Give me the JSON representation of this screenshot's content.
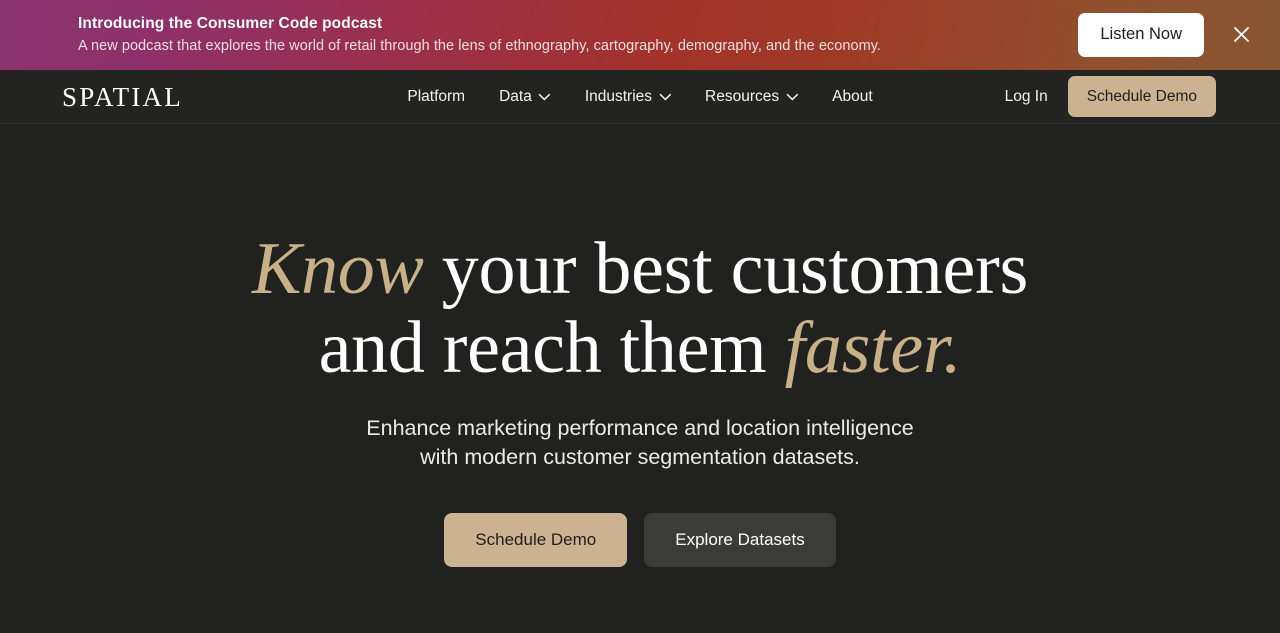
{
  "banner": {
    "title": "Introducing the Consumer Code podcast",
    "subtitle": "A new podcast that explores the world of retail through the lens of ethnography, cartography, demography, and the economy.",
    "cta_label": "Listen Now",
    "close_icon": "close-icon",
    "gradient_start": "#8a3470",
    "gradient_mid": "#a33229",
    "gradient_end": "#885631"
  },
  "nav": {
    "logo": "SPATIAL",
    "links": [
      {
        "label": "Platform",
        "has_dropdown": false
      },
      {
        "label": "Data",
        "has_dropdown": true
      },
      {
        "label": "Industries",
        "has_dropdown": true
      },
      {
        "label": "Resources",
        "has_dropdown": true
      },
      {
        "label": "About",
        "has_dropdown": false
      }
    ],
    "login_label": "Log In",
    "demo_label": "Schedule Demo",
    "accent_color": "#cbb391"
  },
  "hero": {
    "headline": {
      "word_1_accent": "Know",
      "segment_1": " your best customers",
      "segment_2": "and reach them ",
      "word_2_accent": "faster."
    },
    "subheadline": "Enhance marketing performance and location intelligence with modern customer segmentation datasets.",
    "cta_primary": "Schedule Demo",
    "cta_secondary": "Explore Datasets",
    "background_color": "#212220",
    "accent_color": "#c8b189"
  }
}
